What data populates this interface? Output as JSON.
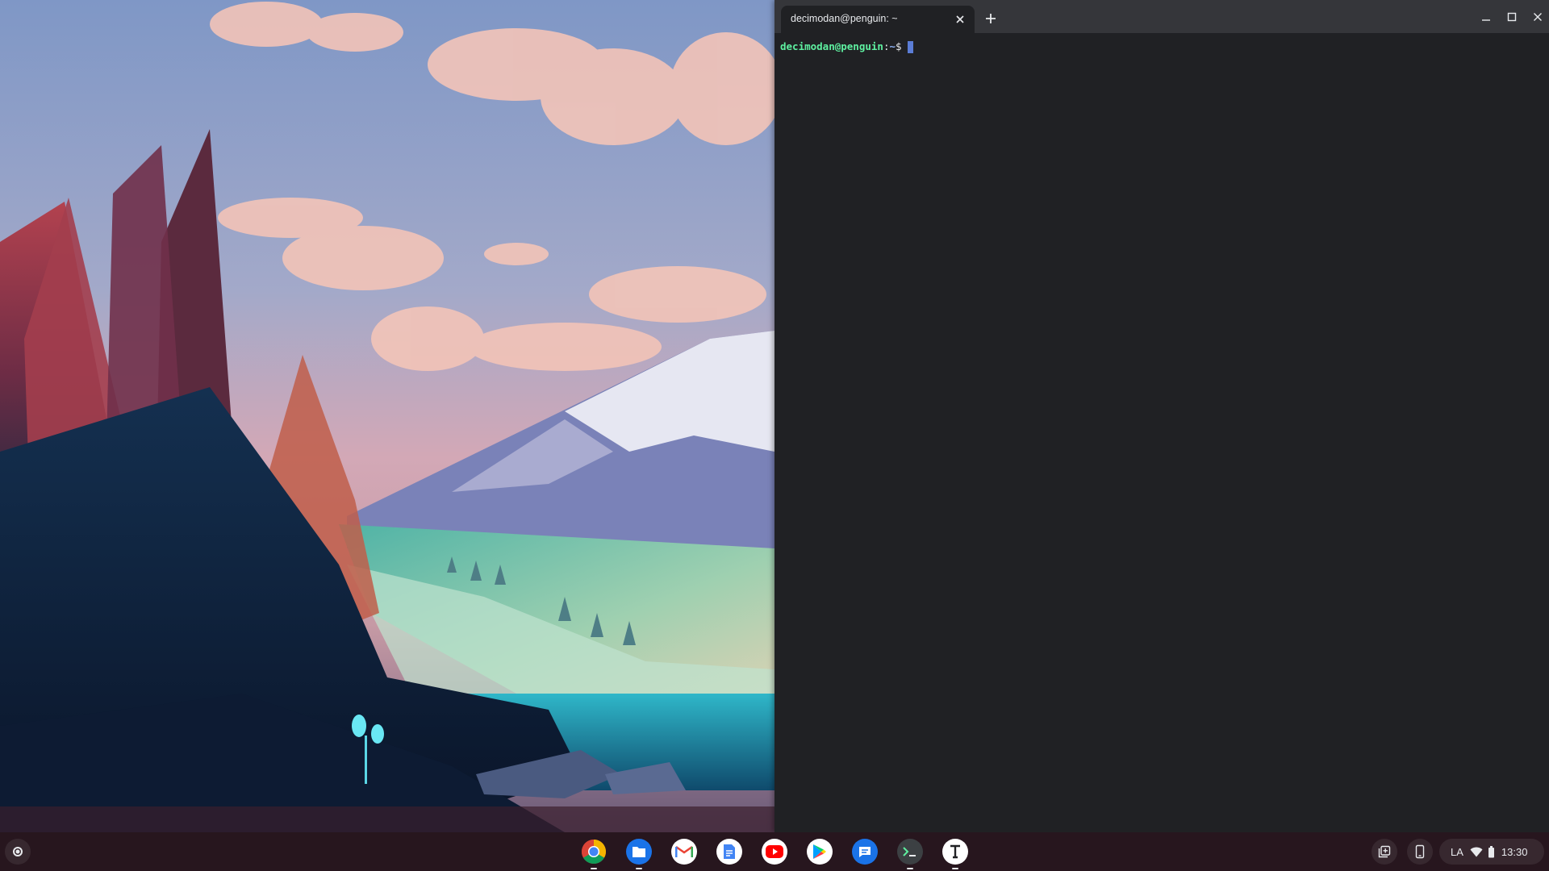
{
  "terminal": {
    "tab_title": "decimodan@penguin: ~",
    "prompt": {
      "user_host": "decimodan@penguin",
      "colon": ":",
      "path": "~",
      "dollar": "$"
    }
  },
  "shelf": {
    "apps": [
      {
        "name": "Chrome",
        "icon": "chrome-icon",
        "running": true
      },
      {
        "name": "Files",
        "icon": "files-icon",
        "running": true
      },
      {
        "name": "Gmail",
        "icon": "gmail-icon",
        "running": false
      },
      {
        "name": "Docs",
        "icon": "docs-icon",
        "running": false
      },
      {
        "name": "YouTube",
        "icon": "youtube-icon",
        "running": false
      },
      {
        "name": "Play Store",
        "icon": "play-store-icon",
        "running": false
      },
      {
        "name": "Messages",
        "icon": "messages-icon",
        "running": false
      },
      {
        "name": "Terminal",
        "icon": "terminal-icon",
        "running": true
      },
      {
        "name": "Text",
        "icon": "text-app-icon",
        "running": true
      }
    ],
    "status": {
      "ime": "LA",
      "time": "13:30"
    }
  },
  "colors": {
    "terminal_bg": "#202124",
    "title_bar": "#35363a",
    "prompt_user": "#5ef0a0",
    "prompt_path": "#8fb4f8",
    "cursor": "#5b7dd6",
    "shelf_bg": "#28161e"
  }
}
